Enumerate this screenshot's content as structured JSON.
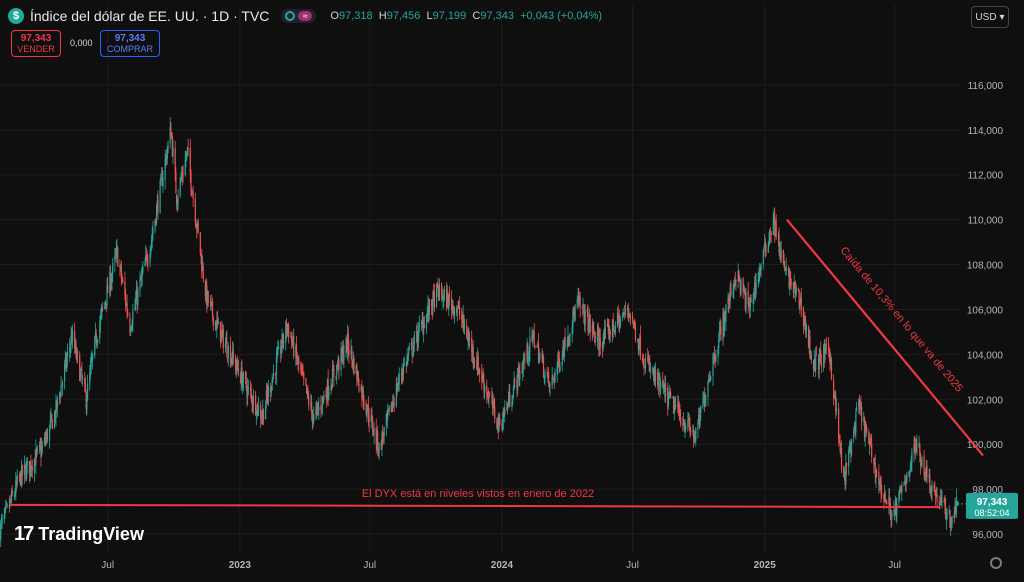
{
  "header": {
    "title": "Índice del dólar de EE. UU. · 1D · TVC",
    "ohlc": [
      {
        "key": "O",
        "value": "97,318"
      },
      {
        "key": "H",
        "value": "97,456"
      },
      {
        "key": "L",
        "value": "97,199"
      },
      {
        "key": "C",
        "value": "97,343"
      },
      {
        "key": "",
        "value": "+0,043 (+0,04%)"
      }
    ],
    "currency": "USD"
  },
  "trade": {
    "sell_price": "97,343",
    "sell_label": "VENDER",
    "spread": "0,000",
    "buy_price": "97,343",
    "buy_label": "COMPRAR"
  },
  "branding": {
    "logo": "TradingView"
  },
  "colors": {
    "up": "#26a69a",
    "down": "#ef5350",
    "annotation": "#f23645",
    "background": "#0f0f0f",
    "grid": "#1d1d1d"
  },
  "chart_data": {
    "type": "candlestick",
    "symbol": "DXY",
    "interval": "1D",
    "ylim": [
      95.2,
      118.0
    ],
    "y_ticks": [
      "96,000",
      "98,000",
      "100,000",
      "102,000",
      "104,000",
      "106,000",
      "108,000",
      "110,000",
      "112,000",
      "114,000",
      "116,000"
    ],
    "y_tick_values": [
      96,
      98,
      100,
      102,
      104,
      106,
      108,
      110,
      112,
      114,
      116
    ],
    "x_range": [
      "2022-02-01",
      "2025-09-30"
    ],
    "x_ticks": [
      {
        "label": "Jul",
        "date": "2022-07-01"
      },
      {
        "label": "2023",
        "date": "2023-01-01"
      },
      {
        "label": "Jul",
        "date": "2023-07-01"
      },
      {
        "label": "2024",
        "date": "2024-01-01"
      },
      {
        "label": "Jul",
        "date": "2024-07-01"
      },
      {
        "label": "2025",
        "date": "2025-01-01"
      },
      {
        "label": "Jul",
        "date": "2025-07-01"
      }
    ],
    "series": [
      {
        "name": "DXY",
        "points": [
          [
            "2022-02-01",
            96.2
          ],
          [
            "2022-03-01",
            98.5
          ],
          [
            "2022-04-01",
            99.8
          ],
          [
            "2022-04-20",
            101.5
          ],
          [
            "2022-05-12",
            104.8
          ],
          [
            "2022-06-01",
            102.0
          ],
          [
            "2022-06-15",
            104.8
          ],
          [
            "2022-07-14",
            108.5
          ],
          [
            "2022-08-01",
            105.3
          ],
          [
            "2022-08-30",
            109.0
          ],
          [
            "2022-09-27",
            114.0
          ],
          [
            "2022-10-05",
            111.0
          ],
          [
            "2022-10-20",
            113.0
          ],
          [
            "2022-11-15",
            106.6
          ],
          [
            "2022-12-01",
            105.2
          ],
          [
            "2023-01-15",
            102.2
          ],
          [
            "2023-02-01",
            101.3
          ],
          [
            "2023-03-08",
            105.3
          ],
          [
            "2023-04-14",
            101.1
          ],
          [
            "2023-05-31",
            104.5
          ],
          [
            "2023-07-14",
            99.8
          ],
          [
            "2023-08-15",
            103.3
          ],
          [
            "2023-10-03",
            106.8
          ],
          [
            "2023-11-01",
            106.0
          ],
          [
            "2023-12-28",
            100.8
          ],
          [
            "2024-02-14",
            104.8
          ],
          [
            "2024-03-08",
            102.5
          ],
          [
            "2024-04-16",
            106.3
          ],
          [
            "2024-05-15",
            104.5
          ],
          [
            "2024-06-26",
            106.0
          ],
          [
            "2024-07-17",
            103.8
          ],
          [
            "2024-08-05",
            102.7
          ],
          [
            "2024-09-27",
            100.3
          ],
          [
            "2024-10-15",
            103.0
          ],
          [
            "2024-11-22",
            107.6
          ],
          [
            "2024-12-10",
            106.0
          ],
          [
            "2025-01-13",
            110.0
          ],
          [
            "2025-01-28",
            107.8
          ],
          [
            "2025-02-20",
            106.3
          ],
          [
            "2025-03-10",
            103.5
          ],
          [
            "2025-04-01",
            104.2
          ],
          [
            "2025-04-21",
            98.3
          ],
          [
            "2025-05-12",
            101.7
          ],
          [
            "2025-06-12",
            98.0
          ],
          [
            "2025-06-30",
            96.8
          ],
          [
            "2025-07-31",
            100.0
          ],
          [
            "2025-08-20",
            98.2
          ],
          [
            "2025-09-17",
            96.6
          ],
          [
            "2025-09-26",
            97.343
          ]
        ]
      }
    ],
    "last_price": "97,343",
    "countdown": "08:52:04",
    "annotations": [
      {
        "type": "hline",
        "y": 97.2,
        "text": "El DYX está en niveles vistos en enero de 2022"
      },
      {
        "type": "trendline",
        "from": [
          "2025-02-01",
          110.0
        ],
        "to": [
          "2025-11-01",
          99.5
        ],
        "text": "Caída de 10,3% en lo que va de 2025"
      }
    ]
  }
}
